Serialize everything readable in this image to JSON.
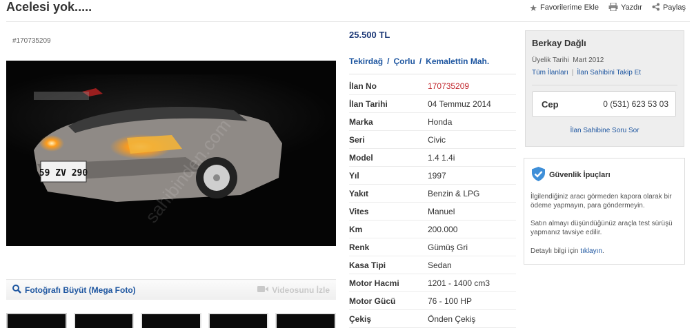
{
  "header": {
    "title": "Acelesi yok.....",
    "actions": [
      {
        "icon": "star-icon",
        "label": "Favorilerime Ekle"
      },
      {
        "icon": "printer-icon",
        "label": "Yazdır"
      },
      {
        "icon": "share-icon",
        "label": "Paylaş"
      }
    ]
  },
  "listing": {
    "id_text": "#170735209",
    "price": "25.500 TL",
    "location": [
      "Tekirdağ",
      "Çorlu",
      "Kemalettin Mah."
    ],
    "location_sep": "/",
    "photo": {
      "plate": "59 ZV 290",
      "mega_label": "Fotoğrafı Büyüt (Mega Foto)",
      "video_label": "Videosunu İzle",
      "thumb_count": 5
    },
    "specs": [
      {
        "k": "İlan No",
        "v": "170735209",
        "highlight": true
      },
      {
        "k": "İlan Tarihi",
        "v": "04 Temmuz 2014"
      },
      {
        "k": "Marka",
        "v": "Honda"
      },
      {
        "k": "Seri",
        "v": "Civic"
      },
      {
        "k": "Model",
        "v": "1.4 1.4i"
      },
      {
        "k": "Yıl",
        "v": "1997"
      },
      {
        "k": "Yakıt",
        "v": "Benzin & LPG"
      },
      {
        "k": "Vites",
        "v": "Manuel"
      },
      {
        "k": "Km",
        "v": "200.000"
      },
      {
        "k": "Renk",
        "v": "Gümüş Gri"
      },
      {
        "k": "Kasa Tipi",
        "v": "Sedan"
      },
      {
        "k": "Motor Hacmi",
        "v": "1201 - 1400 cm3"
      },
      {
        "k": "Motor Gücü",
        "v": "76 - 100 HP"
      },
      {
        "k": "Çekiş",
        "v": "Önden Çekiş"
      }
    ]
  },
  "seller": {
    "name": "Berkay Dağlı",
    "since_label": "Üyelik Tarihi",
    "since_value": "Mart 2012",
    "all_listings": "Tüm İlanları",
    "follow": "İlan Sahibini Takip Et",
    "phone_label": "Cep",
    "phone_number": "0 (531) 623 53 03",
    "ask": "İlan Sahibine Soru Sor"
  },
  "tips": {
    "title": "Güvenlik İpuçları",
    "p1": "İlgilendiğiniz aracı görmeden kapora olarak bir ödeme yapmayın, para göndermeyin.",
    "p2": "Satın almayı düşündüğünüz araçla test sürüşü yapmanız tavsiye edilir.",
    "p3_prefix": "Detaylı bilgi için ",
    "p3_link": "tıklayın",
    "p3_suffix": "."
  },
  "colors": {
    "link": "#1e56a0",
    "price": "#1e3a78",
    "highlight": "#c1272d"
  }
}
